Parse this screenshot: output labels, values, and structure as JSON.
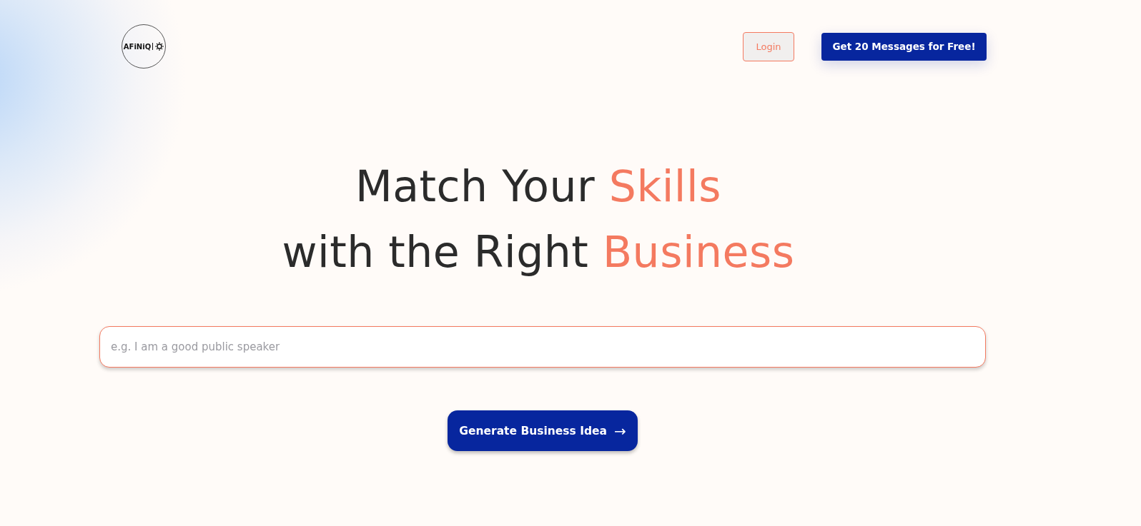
{
  "logo": {
    "text": "AFiNiQ"
  },
  "nav": {
    "login": "Login",
    "cta": "Get 20 Messages for Free!"
  },
  "headline": [
    [
      {
        "text": "Match Your ",
        "accent": false
      },
      {
        "text": "Skills",
        "accent": true
      }
    ],
    [
      {
        "text": "with the Right ",
        "accent": false
      },
      {
        "text": "Business",
        "accent": true
      }
    ]
  ],
  "search": {
    "placeholder": "e.g. I am a good public speaker"
  },
  "generate_button": {
    "label": "Generate Business Idea",
    "arrow": "→"
  }
}
